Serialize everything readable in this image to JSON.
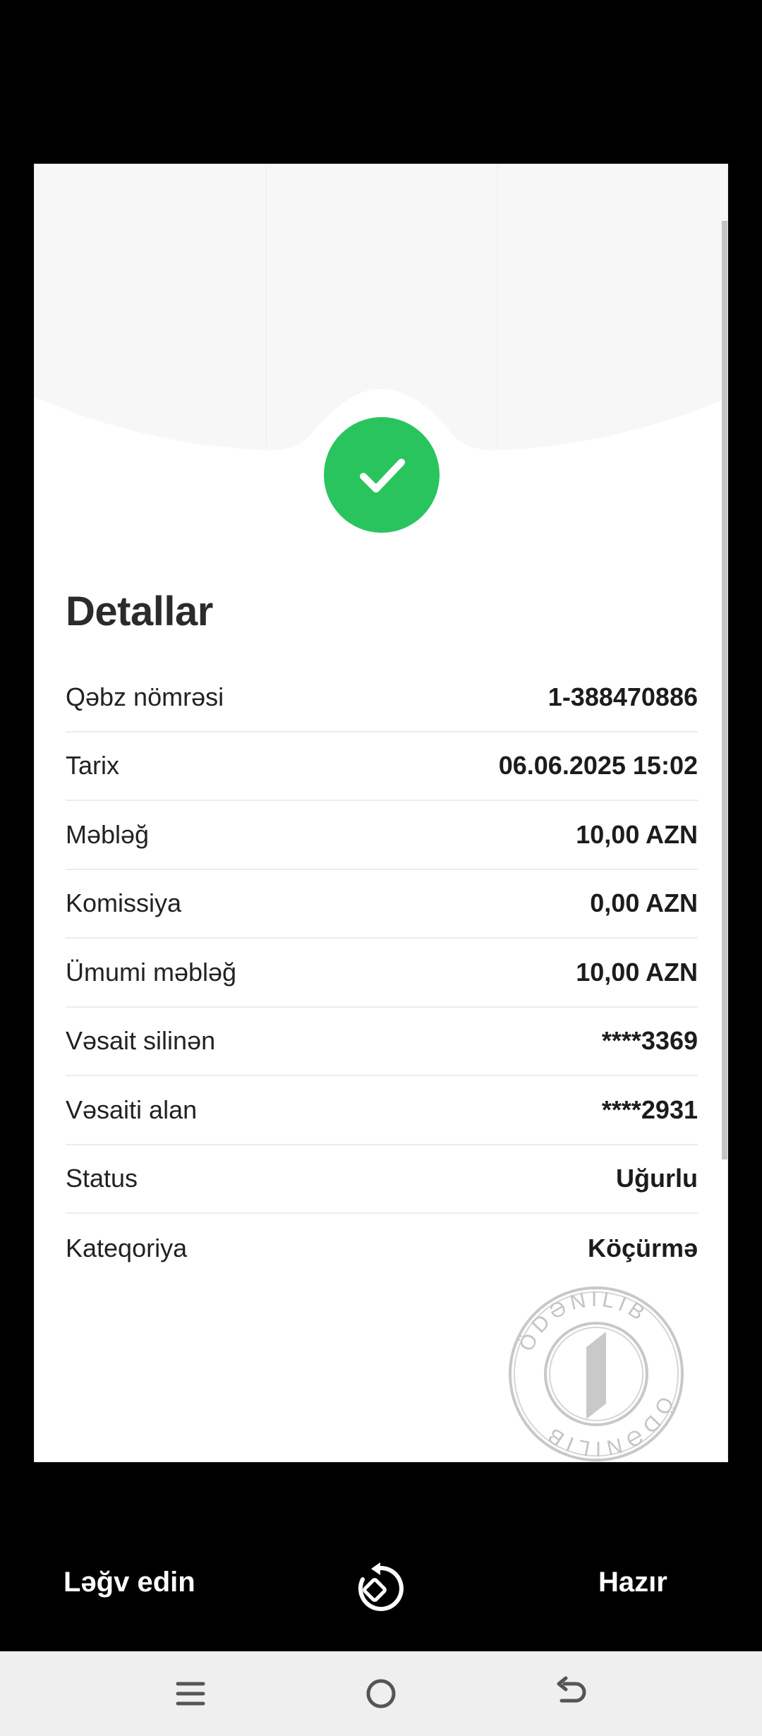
{
  "details": {
    "title": "Detallar",
    "rows": [
      {
        "label": "Qəbz nömrəsi",
        "value": "1-388470886"
      },
      {
        "label": "Tarix",
        "value": "06.06.2025 15:02"
      },
      {
        "label": "Məbləğ",
        "value": "10,00 AZN"
      },
      {
        "label": "Komissiya",
        "value": "0,00 AZN"
      },
      {
        "label": "Ümumi məbləğ",
        "value": "10,00 AZN"
      },
      {
        "label": "Vəsait silinən",
        "value": "****3369"
      },
      {
        "label": "Vəsaiti alan",
        "value": "****2931"
      },
      {
        "label": "Status",
        "value": "Uğurlu"
      },
      {
        "label": "Kateqoriya",
        "value": "Köçürmə"
      }
    ]
  },
  "stamp": {
    "text": "ÖDƏNİLİB"
  },
  "actions": {
    "cancel_label": "Ləğv edin",
    "done_label": "Hazır"
  },
  "icons": {
    "success": "check-icon",
    "rotate": "rotate-icon",
    "nav_recents": "menu-icon",
    "nav_home": "home-icon",
    "nav_back": "back-icon"
  },
  "colors": {
    "success": "#2ac45f",
    "background": "#000000",
    "card": "#ffffff"
  }
}
